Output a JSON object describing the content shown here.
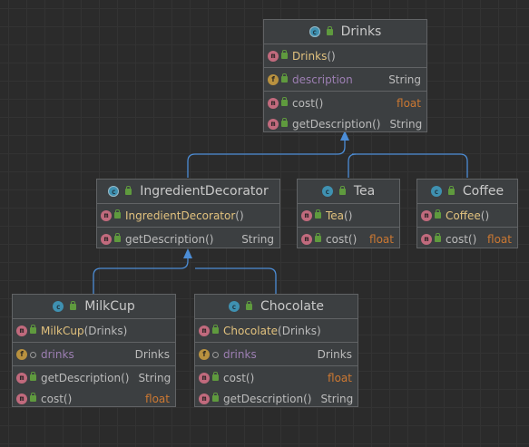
{
  "classes": {
    "drinks": {
      "title": "Drinks",
      "constructor": {
        "name": "Drinks",
        "params": "()"
      },
      "field": {
        "name": "description",
        "type": "String"
      },
      "methods": [
        {
          "name": "cost",
          "params": "()",
          "type": "float"
        },
        {
          "name": "getDescription",
          "params": "()",
          "type": "String"
        }
      ]
    },
    "ingredient": {
      "title": "IngredientDecorator",
      "constructor": {
        "name": "IngredientDecorator",
        "params": "()"
      },
      "methods": [
        {
          "name": "getDescription",
          "params": "()",
          "type": "String"
        }
      ]
    },
    "tea": {
      "title": "Tea",
      "constructor": {
        "name": "Tea",
        "params": "()"
      },
      "methods": [
        {
          "name": "cost",
          "params": "()",
          "type": "float"
        }
      ]
    },
    "coffee": {
      "title": "Coffee",
      "constructor": {
        "name": "Coffee",
        "params": "()"
      },
      "methods": [
        {
          "name": "cost",
          "params": "()",
          "type": "float"
        }
      ]
    },
    "milkcup": {
      "title": "MilkCup",
      "constructor": {
        "name": "MilkCup",
        "params": "(Drinks)"
      },
      "field": {
        "name": "drinks",
        "type": "Drinks"
      },
      "methods": [
        {
          "name": "getDescription",
          "params": "()",
          "type": "String"
        },
        {
          "name": "cost",
          "params": "()",
          "type": "float"
        }
      ]
    },
    "chocolate": {
      "title": "Chocolate",
      "constructor": {
        "name": "Chocolate",
        "params": "(Drinks)"
      },
      "field": {
        "name": "drinks",
        "type": "Drinks"
      },
      "methods": [
        {
          "name": "cost",
          "params": "()",
          "type": "float"
        },
        {
          "name": "getDescription",
          "params": "()",
          "type": "String"
        }
      ]
    }
  },
  "colors": {
    "edge": "#4c8dd6",
    "method_badge": "#c16a7d",
    "field_badge": "#b8913f",
    "class_badge": "#3f91b1",
    "numeric_type": "#cc7832"
  },
  "icons": {
    "class": "c",
    "method": "m",
    "field": "f"
  }
}
